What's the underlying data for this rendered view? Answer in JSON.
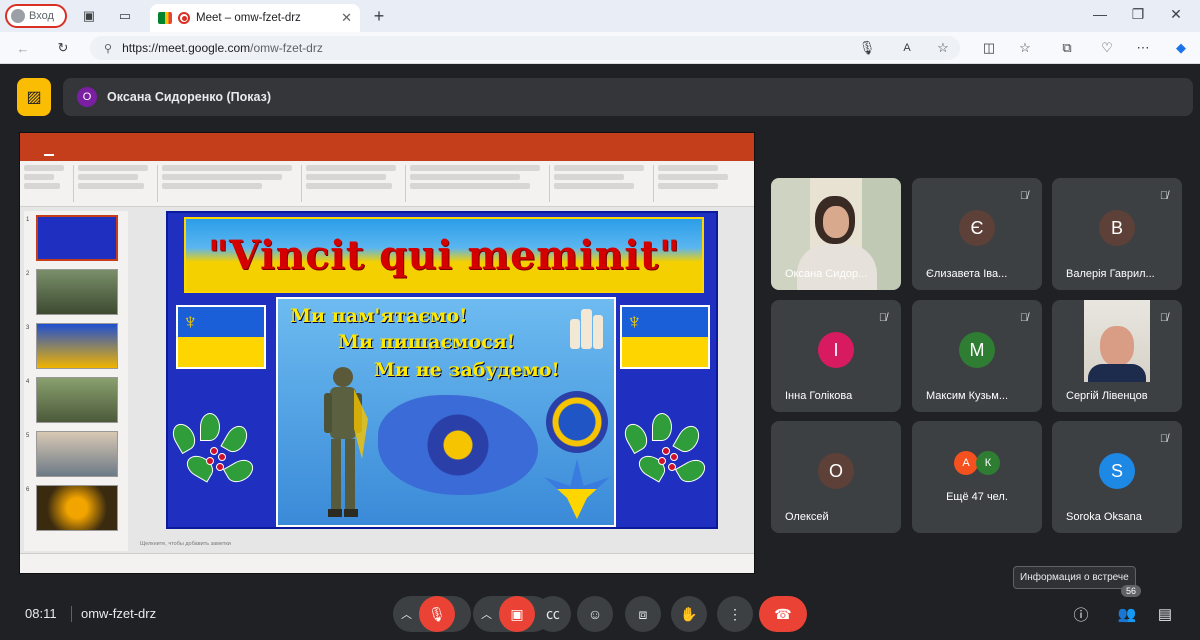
{
  "browser": {
    "profile_label": "Вход",
    "tab_title": "Meet – omw-fzet-drz",
    "url_host": "https://meet.google.com",
    "url_path": "/omw-fzet-drz"
  },
  "meet": {
    "presenter_initial": "О",
    "presenter_label": "Оксана Сидоренко (Показ)",
    "slide": {
      "banner": "\"Vincit qui meminit\"",
      "lines": [
        "Ми пам'ятаємо!",
        "Ми пишаємося!",
        "Ми не забудемо!"
      ]
    },
    "slide_numbers": [
      "1",
      "2",
      "3",
      "4",
      "5",
      "6"
    ],
    "notes_placeholder": "Щелкните, чтобы добавить заметки",
    "participants": [
      {
        "name": "Оксана Сидор...",
        "initial": "",
        "color": "",
        "muted": false,
        "photo": "woman"
      },
      {
        "name": "Єлизавета Іва...",
        "initial": "Є",
        "color": "#5d4037",
        "muted": true
      },
      {
        "name": "Валерія Гаврил...",
        "initial": "В",
        "color": "#5d4037",
        "muted": true
      },
      {
        "name": "Інна Голікова",
        "initial": "І",
        "color": "#d81b60",
        "muted": true
      },
      {
        "name": "Максим Кузьм...",
        "initial": "М",
        "color": "#2e7d32",
        "muted": true
      },
      {
        "name": "Сергій Лівенцов",
        "initial": "",
        "color": "",
        "muted": true,
        "photo": "man"
      },
      {
        "name": "Олексей",
        "initial": "О",
        "color": "#5d4037",
        "muted": false
      },
      {
        "name": "Ещё 47 чел.",
        "initial": "",
        "color": "",
        "muted": false,
        "mini": [
          "А",
          "К"
        ]
      },
      {
        "name": "Soroka Oksana",
        "initial": "S",
        "color": "#1e88e5",
        "muted": true
      }
    ],
    "mini_colors": [
      "#f4511e",
      "#2e7d32"
    ],
    "time": "08:11",
    "meeting_code": "omw-fzet-drz",
    "tooltip": "Информация о встрече",
    "participant_count": "56"
  },
  "colors": {
    "accent_red": "#ea4335",
    "cam_yellow": "#fbbc04",
    "ppt_orange": "#c43e1c"
  }
}
